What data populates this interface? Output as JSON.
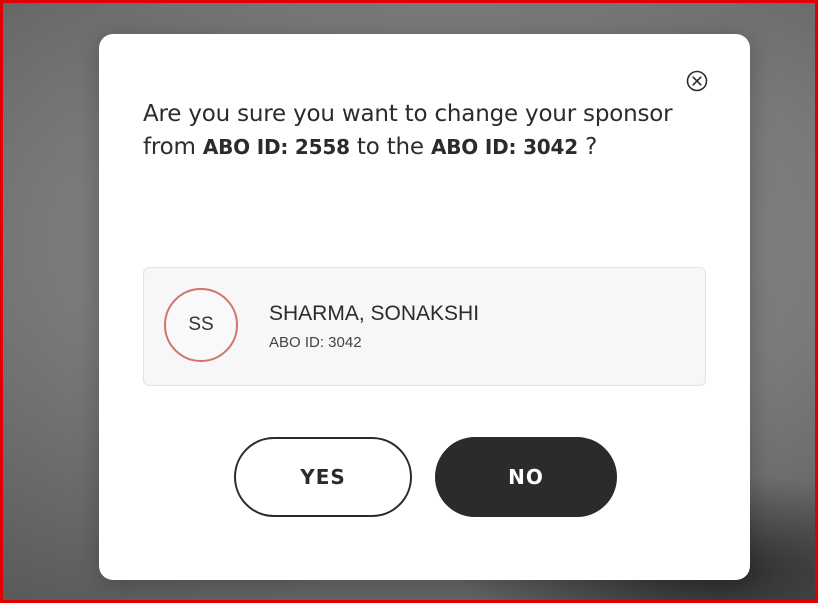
{
  "dialog": {
    "message": {
      "intro": "Are you sure you want to change your sponsor from ",
      "current_id": "ABO ID: 2558",
      "middle": " to the ",
      "new_id": "ABO ID: 3042",
      "end": " ?"
    },
    "close_icon": "close-circle-icon"
  },
  "sponsor": {
    "initials": "SS",
    "name": "SHARMA, SONAKSHI",
    "abo_id": "ABO ID: 3042"
  },
  "buttons": {
    "yes_label": "YES",
    "no_label": "NO"
  },
  "colors": {
    "highlight_border": "#e00000",
    "avatar_ring": "#d0766a",
    "primary_dark": "#2b2b2b"
  }
}
